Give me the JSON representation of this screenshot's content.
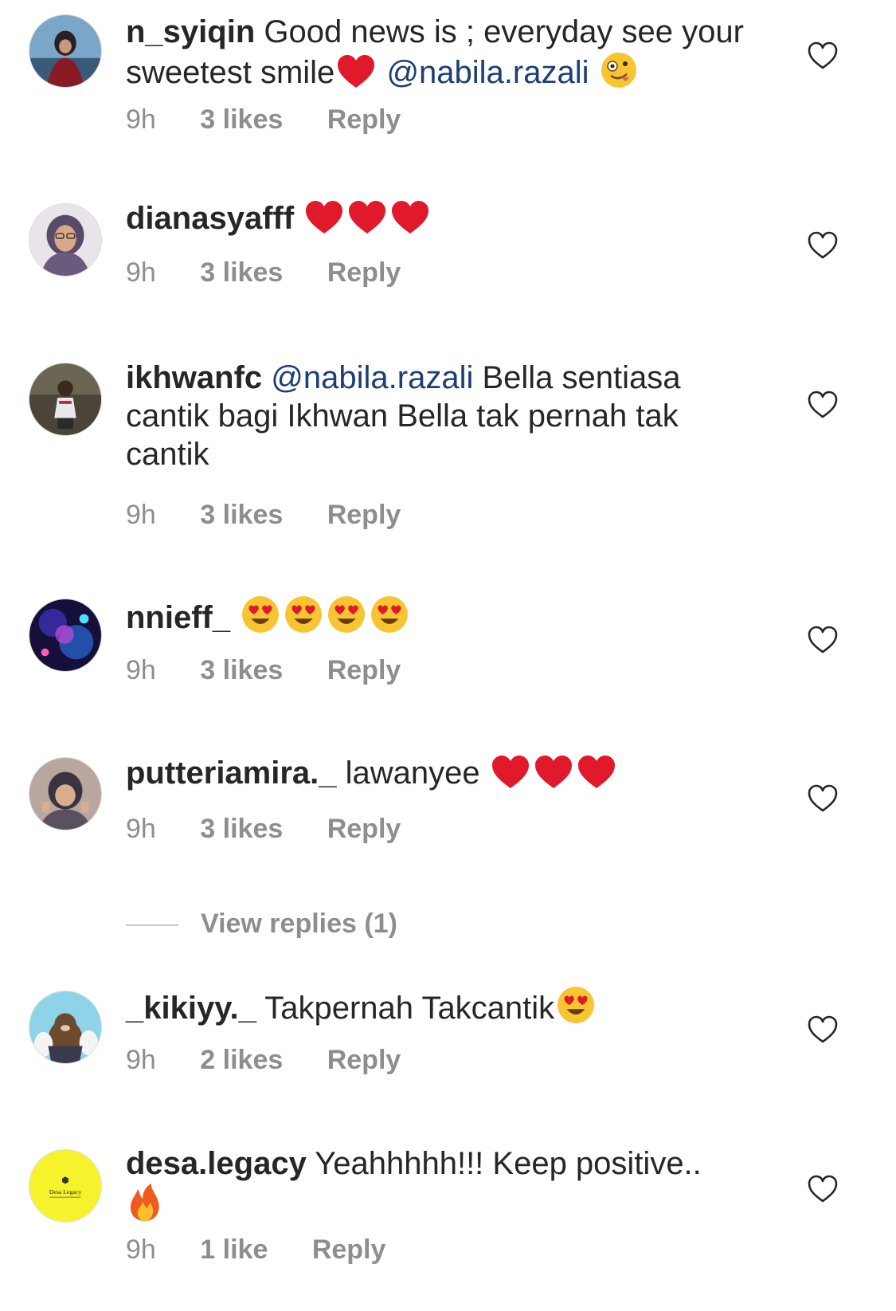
{
  "comments": [
    {
      "username": "n_syiqin",
      "text_before": "Good news is ; everyday see your sweetest smile",
      "emoji_after_text": "❤️",
      "mention": "@nabila.razali",
      "emoji_end": "🤪",
      "time": "9h",
      "likes": "3 likes",
      "reply": "Reply"
    },
    {
      "username": "dianasyafff",
      "emojis": "❤️❤️❤️",
      "time": "9h",
      "likes": "3 likes",
      "reply": "Reply"
    },
    {
      "username": "ikhwanfc",
      "mention": "@nabila.razali",
      "text_after": "Bella sentiasa cantik bagi Ikhwan Bella tak pernah tak cantik",
      "time": "9h",
      "likes": "3 likes",
      "reply": "Reply"
    },
    {
      "username": "nnieff_",
      "emojis": "😍😍😍😍",
      "time": "9h",
      "likes": "3 likes",
      "reply": "Reply"
    },
    {
      "username": "putteriamira._",
      "text": "lawanyee",
      "emojis": "❤️❤️❤️",
      "time": "9h",
      "likes": "3 likes",
      "reply": "Reply"
    },
    {
      "username": "_kikiyy._",
      "text": "Takpernah Takcantik",
      "emojis": "😍",
      "time": "9h",
      "likes": "2 likes",
      "reply": "Reply"
    },
    {
      "username": "desa.legacy",
      "text": "Yeahhhhh!!! Keep positive..",
      "emojis": "🔥",
      "time": "9h",
      "likes": "1 like",
      "reply": "Reply"
    }
  ],
  "view_replies": "View replies (1)",
  "avatar_logo_text": "Desa Legacy",
  "colors": {
    "text": "#262626",
    "meta": "#8e8e8e",
    "mention": "#1d3e74",
    "heart_red": "#e0192b",
    "desa_logo_bg": "#f6f22c"
  }
}
